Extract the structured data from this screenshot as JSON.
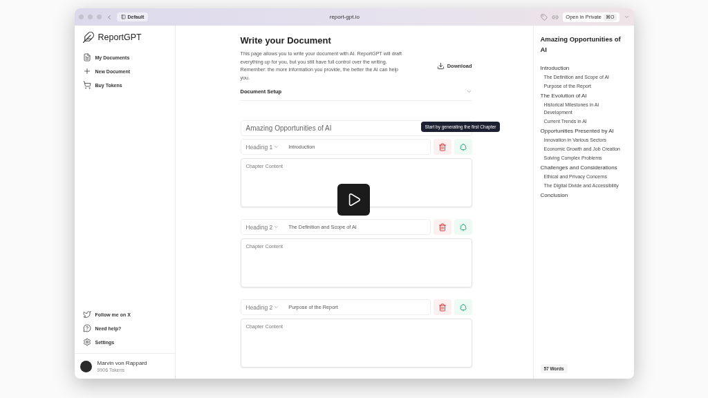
{
  "browser": {
    "tab": "Default",
    "url": "report-gpt.io",
    "private_button": "Open in Private",
    "shortcut": "⌘O"
  },
  "sidebar": {
    "logo": "ReportGPT",
    "nav": [
      {
        "label": "My Documents",
        "kind": "document"
      },
      {
        "label": "New Document",
        "kind": "plus"
      },
      {
        "label": "Buy Tokens",
        "kind": "cart"
      }
    ],
    "footer_links": [
      {
        "label": "Follow me on X",
        "kind": "bird"
      },
      {
        "label": "Need help?",
        "kind": "help"
      },
      {
        "label": "Settings",
        "kind": "settings"
      }
    ],
    "user": {
      "name": "Marvin von Rappard",
      "tokens": "9906 Tokens"
    }
  },
  "main": {
    "title": "Write your Document",
    "description": "This page allows you to write your document with AI. ReportGPT will draft everything up for you, but you still have full control over the writing. Remember: the more information you provide, the better the AI can help you.",
    "download": "Download",
    "setup": {
      "label": "Document Setup",
      "expanded": false
    },
    "document_title": "Amazing Opportunities of AI",
    "tooltip": "Start by generating the first Chapter",
    "chapters": [
      {
        "level": "Heading 1",
        "title": "Introduction",
        "placeholder": "Chapter Content"
      },
      {
        "level": "Heading 2",
        "title": "The Definition and Scope of AI",
        "placeholder": "Chapter Content"
      },
      {
        "level": "Heading 2",
        "title": "Purpose of the Report",
        "placeholder": "Chapter Content"
      }
    ]
  },
  "outline": {
    "title": "Amazing Opportunities of AI",
    "items": [
      {
        "label": "Introduction",
        "children": [
          {
            "label": "The Definition and Scope of AI"
          },
          {
            "label": "Purpose of the Report"
          }
        ]
      },
      {
        "label": "The Evolution of AI",
        "children": [
          {
            "label": "Historical Milestones in AI Development"
          },
          {
            "label": "Current Trends in AI"
          }
        ]
      },
      {
        "label": "Opportunities Presented by AI",
        "children": [
          {
            "label": "Innovation in Various Sectors"
          },
          {
            "label": "Economic Growth and Job Creation"
          },
          {
            "label": "Solving Complex Problems"
          }
        ]
      },
      {
        "label": "Challenges and Considerations",
        "children": [
          {
            "label": "Ethical and Privacy Concerns"
          },
          {
            "label": "The Digital Divide and Accessibility"
          }
        ]
      },
      {
        "label": "Conclusion"
      }
    ],
    "word_count": "57 Words"
  },
  "video": {
    "play": true
  }
}
